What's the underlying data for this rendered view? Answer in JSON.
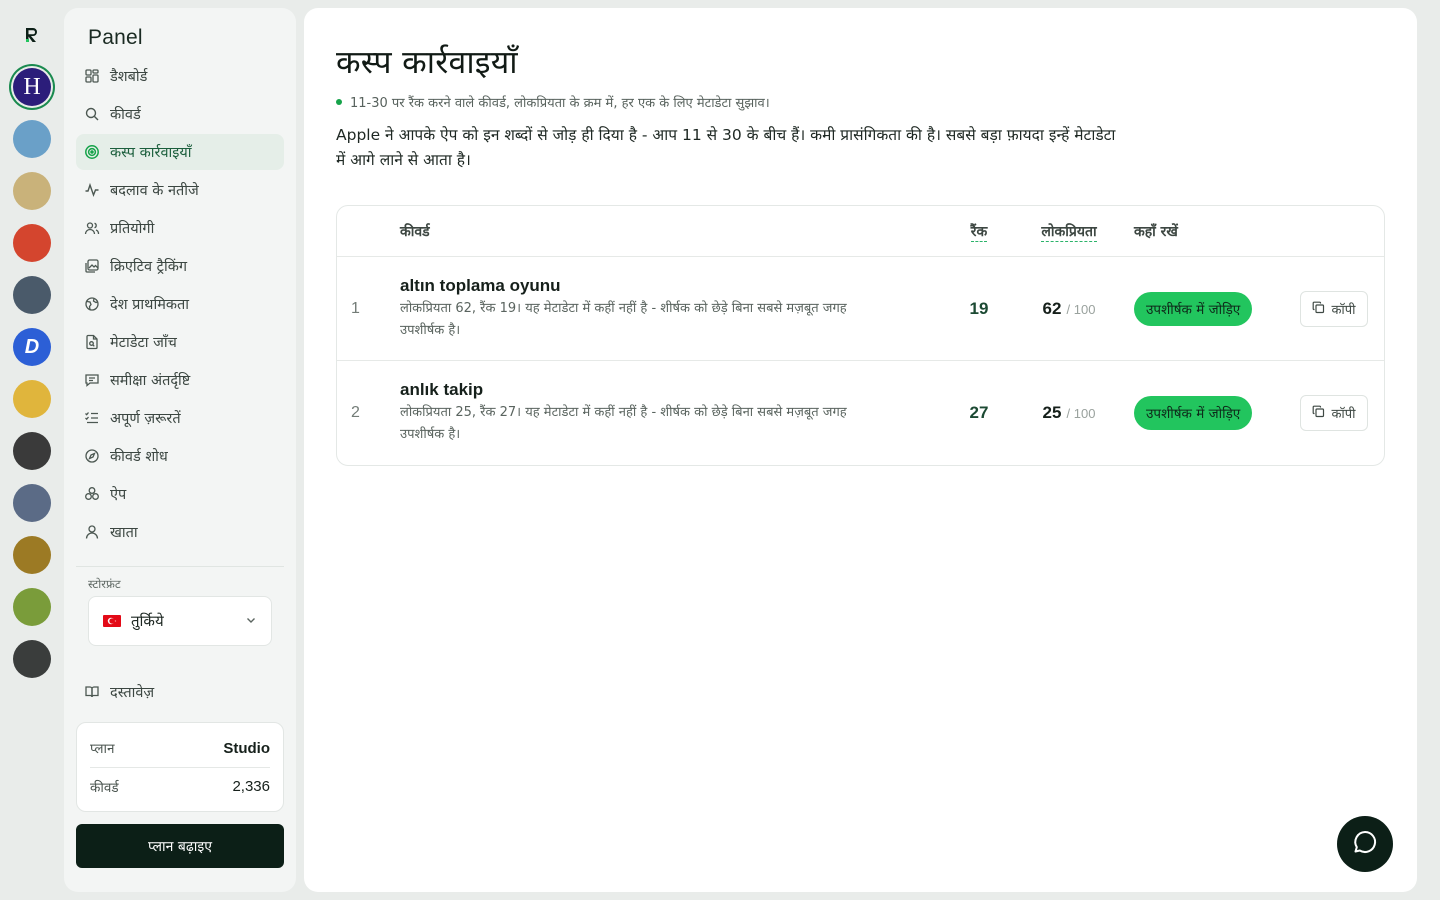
{
  "rail": {
    "logo_letter": "R",
    "apps": [
      {
        "name": "app-h",
        "letter": "H",
        "bg": "#2b1d7a",
        "active": true
      },
      {
        "name": "app-runner",
        "letter": "",
        "bg": "#6aa0c8"
      },
      {
        "name": "app-gold",
        "letter": "",
        "bg": "#c9b27a"
      },
      {
        "name": "app-blocks",
        "letter": "",
        "bg": "#d4452e"
      },
      {
        "name": "app-chart",
        "letter": "",
        "bg": "#4a5a6a"
      },
      {
        "name": "app-d",
        "letter": "D",
        "bg": "#2c5fd6"
      },
      {
        "name": "app-ticket",
        "letter": "",
        "bg": "#e0b53c"
      },
      {
        "name": "app-investing",
        "letter": "",
        "bg": "#3a3a3a"
      },
      {
        "name": "app-girl",
        "letter": "",
        "bg": "#5b6b86"
      },
      {
        "name": "app-temple",
        "letter": "",
        "bg": "#9c7a24"
      },
      {
        "name": "app-temple2",
        "letter": "",
        "bg": "#7a9c3a"
      },
      {
        "name": "app-tv",
        "letter": "",
        "bg": "#3a3d3c"
      }
    ]
  },
  "sidebar": {
    "brand": "Panel",
    "nav": [
      {
        "name": "nav-dashboard",
        "label": "डैशबोर्ड",
        "icon": "grid-icon"
      },
      {
        "name": "nav-keywords",
        "label": "कीवर्ड",
        "icon": "search-icon"
      },
      {
        "name": "nav-cusp-actions",
        "label": "कस्प कार्रवाइयाँ",
        "icon": "target-icon",
        "active": true
      },
      {
        "name": "nav-change-results",
        "label": "बदलाव के नतीजे",
        "icon": "activity-icon"
      },
      {
        "name": "nav-competitors",
        "label": "प्रतियोगी",
        "icon": "users-icon"
      },
      {
        "name": "nav-creative-tracking",
        "label": "क्रिएटिव ट्रैकिंग",
        "icon": "images-icon"
      },
      {
        "name": "nav-country-priority",
        "label": "देश प्राथमिकता",
        "icon": "globe-icon"
      },
      {
        "name": "nav-metadata-check",
        "label": "मेटाडेटा जाँच",
        "icon": "file-search-icon"
      },
      {
        "name": "nav-review-insights",
        "label": "समीक्षा अंतर्दृष्टि",
        "icon": "message-icon"
      },
      {
        "name": "nav-unmet-needs",
        "label": "अपूर्ण ज़रूरतें",
        "icon": "list-check-icon"
      },
      {
        "name": "nav-keyword-research",
        "label": "कीवर्ड शोध",
        "icon": "compass-icon"
      },
      {
        "name": "nav-apps",
        "label": "ऐप",
        "icon": "apps-icon"
      },
      {
        "name": "nav-account",
        "label": "खाता",
        "icon": "user-icon"
      }
    ],
    "storefront_label": "स्टोरफ्रंट",
    "storefront_value": "तुर्किये",
    "docs_label": "दस्तावेज़",
    "plan_label": "प्लान",
    "plan_value": "Studio",
    "keywords_label": "कीवर्ड",
    "keywords_value": "2,336",
    "upgrade_label": "प्लान बढ़ाइए"
  },
  "main": {
    "title": "कस्प कार्रवाइयाँ",
    "subtitle": "11-30 पर रैंक करने वाले कीवर्ड, लोकप्रियता के क्रम में, हर एक के लिए मेटाडेटा सुझाव।",
    "intro": "Apple ने आपके ऐप को इन शब्दों से जोड़ ही दिया है - आप 11 से 30 के बीच हैं। कमी प्रासंगिकता की है। सबसे बड़ा फ़ायदा इन्हें मेटाडेटा में आगे लाने से आता है।",
    "table": {
      "headers": {
        "keyword": "कीवर्ड",
        "rank": "रैंक",
        "popularity": "लोकप्रियता",
        "placement": "कहाँ रखें"
      },
      "rows": [
        {
          "index": "1",
          "keyword": "altın toplama oyunu",
          "description": "लोकप्रियता 62, रैंक 19। यह मेटाडेटा में कहीं नहीं है - शीर्षक को छेड़े बिना सबसे मज़बूत जगह उपशीर्षक है।",
          "rank": "19",
          "popularity": "62",
          "popularity_max": "/ 100",
          "action": "उपशीर्षक में जोड़िए",
          "copy": "कॉपी"
        },
        {
          "index": "2",
          "keyword": "anlık takip",
          "description": "लोकप्रियता 25, रैंक 27। यह मेटाडेटा में कहीं नहीं है - शीर्षक को छेड़े बिना सबसे मज़बूत जगह उपशीर्षक है।",
          "rank": "27",
          "popularity": "25",
          "popularity_max": "/ 100",
          "action": "उपशीर्षक में जोड़िए",
          "copy": "कॉपी"
        }
      ]
    }
  },
  "colors": {
    "accent": "#22c55e",
    "dark": "#0c1f17"
  }
}
